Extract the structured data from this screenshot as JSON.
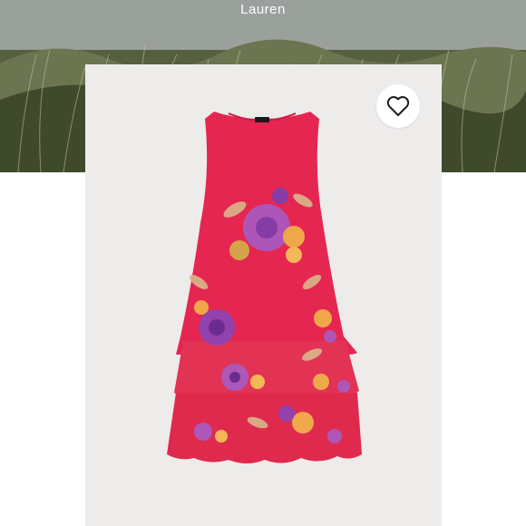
{
  "header": {
    "brand": "Lauren"
  },
  "product": {
    "image_icon": "dress-image",
    "favorite_icon": "heart-icon",
    "colors": {
      "dress": "#e52650",
      "card_background": "#eeeceb"
    }
  }
}
